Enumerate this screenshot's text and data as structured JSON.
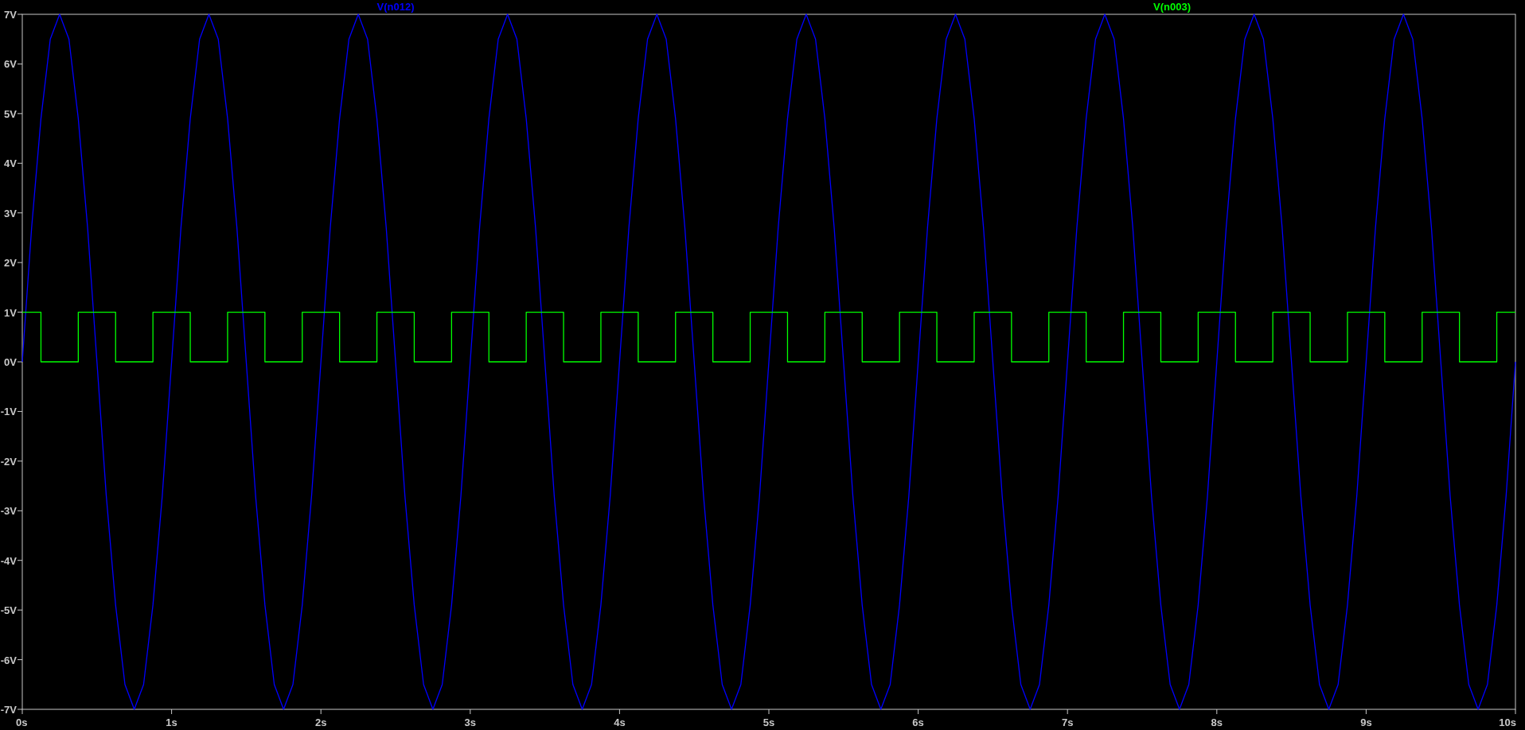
{
  "waveform_plot": {
    "chart_data": {
      "type": "line",
      "x": [
        0,
        0.0625,
        0.125,
        0.125,
        0.1875,
        0.25,
        0.3125,
        0.375,
        0.375,
        0.4375,
        0.5,
        0.5625,
        0.625,
        0.625,
        0.6875,
        0.75,
        0.8125,
        0.875,
        0.875,
        0.9375,
        1,
        1.0625,
        1.125,
        1.125,
        1.1875,
        1.25,
        1.3125,
        1.375,
        1.375,
        1.4375,
        1.5,
        1.5625,
        1.625,
        1.625,
        1.6875,
        1.75,
        1.8125,
        1.875,
        1.875,
        1.9375,
        2,
        2.0625,
        2.125,
        2.125,
        2.1875,
        2.25,
        2.3125,
        2.375,
        2.375,
        2.4375,
        2.5,
        2.5625,
        2.625,
        2.625,
        2.6875,
        2.75,
        2.8125,
        2.875,
        2.875,
        2.9375,
        3,
        3.0625,
        3.125,
        3.125,
        3.1875,
        3.25,
        3.3125,
        3.375,
        3.375,
        3.4375,
        3.5,
        3.5625,
        3.625,
        3.625,
        3.6875,
        3.75,
        3.8125,
        3.875,
        3.875,
        3.9375,
        4,
        4.0625,
        4.125,
        4.125,
        4.1875,
        4.25,
        4.3125,
        4.375,
        4.375,
        4.4375,
        4.5,
        4.5625,
        4.625,
        4.625,
        4.6875,
        4.75,
        4.8125,
        4.875,
        4.875,
        4.9375,
        5,
        5.0625,
        5.125,
        5.125,
        5.1875,
        5.25,
        5.3125,
        5.375,
        5.375,
        5.4375,
        5.5,
        5.5625,
        5.625,
        5.625,
        5.6875,
        5.75,
        5.8125,
        5.875,
        5.875,
        5.9375,
        6,
        6.0625,
        6.125,
        6.125,
        6.1875,
        6.25,
        6.3125,
        6.375,
        6.375,
        6.4375,
        6.5,
        6.5625,
        6.625,
        6.625,
        6.6875,
        6.75,
        6.8125,
        6.875,
        6.875,
        6.9375,
        7,
        7.0625,
        7.125,
        7.125,
        7.1875,
        7.25,
        7.3125,
        7.375,
        7.375,
        7.4375,
        7.5,
        7.5625,
        7.625,
        7.625,
        7.6875,
        7.75,
        7.8125,
        7.875,
        7.875,
        7.9375,
        8,
        8.0625,
        8.125,
        8.125,
        8.1875,
        8.25,
        8.3125,
        8.375,
        8.375,
        8.4375,
        8.5,
        8.5625,
        8.625,
        8.625,
        8.6875,
        8.75,
        8.8125,
        8.875,
        8.875,
        8.9375,
        9,
        9.0625,
        9.125,
        9.125,
        9.1875,
        9.25,
        9.3125,
        9.375,
        9.375,
        9.4375,
        9.5,
        9.5625,
        9.625,
        9.625,
        9.6875,
        9.75,
        9.8125,
        9.875,
        9.875,
        9.9375,
        10
      ],
      "series": [
        {
          "name": "V(n012)",
          "color": "#0000ff",
          "values": [
            0,
            2.7,
            4.9,
            4.9,
            6.5,
            7,
            6.5,
            4.9,
            4.9,
            2.7,
            0,
            -2.7,
            -4.9,
            -4.9,
            -6.5,
            -7,
            -6.5,
            -4.9,
            -4.9,
            -2.7,
            0,
            2.7,
            4.9,
            4.9,
            6.5,
            7,
            6.5,
            4.9,
            4.9,
            2.7,
            0,
            -2.7,
            -4.9,
            -4.9,
            -6.5,
            -7,
            -6.5,
            -4.9,
            -4.9,
            -2.7,
            0,
            2.7,
            4.9,
            4.9,
            6.5,
            7,
            6.5,
            4.9,
            4.9,
            2.7,
            0,
            -2.7,
            -4.9,
            -4.9,
            -6.5,
            -7,
            -6.5,
            -4.9,
            -4.9,
            -2.7,
            0,
            2.7,
            4.9,
            4.9,
            6.5,
            7,
            6.5,
            4.9,
            4.9,
            2.7,
            0,
            -2.7,
            -4.9,
            -4.9,
            -6.5,
            -7,
            -6.5,
            -4.9,
            -4.9,
            -2.7,
            0,
            2.7,
            4.9,
            4.9,
            6.5,
            7,
            6.5,
            4.9,
            4.9,
            2.7,
            0,
            -2.7,
            -4.9,
            -4.9,
            -6.5,
            -7,
            -6.5,
            -4.9,
            -4.9,
            -2.7,
            0,
            2.7,
            4.9,
            4.9,
            6.5,
            7,
            6.5,
            4.9,
            4.9,
            2.7,
            0,
            -2.7,
            -4.9,
            -4.9,
            -6.5,
            -7,
            -6.5,
            -4.9,
            -4.9,
            -2.7,
            0,
            2.7,
            4.9,
            4.9,
            6.5,
            7,
            6.5,
            4.9,
            4.9,
            2.7,
            0,
            -2.7,
            -4.9,
            -4.9,
            -6.5,
            -7,
            -6.5,
            -4.9,
            -4.9,
            -2.7,
            0,
            2.7,
            4.9,
            4.9,
            6.5,
            7,
            6.5,
            4.9,
            4.9,
            2.7,
            0,
            -2.7,
            -4.9,
            -4.9,
            -6.5,
            -7,
            -6.5,
            -4.9,
            -4.9,
            -2.7,
            0,
            2.7,
            4.9,
            4.9,
            6.5,
            7,
            6.5,
            4.9,
            4.9,
            2.7,
            0,
            -2.7,
            -4.9,
            -4.9,
            -6.5,
            -7,
            -6.5,
            -4.9,
            -4.9,
            -2.7,
            0,
            2.7,
            4.9,
            4.9,
            6.5,
            7,
            6.5,
            4.9,
            4.9,
            2.7,
            0,
            -2.7,
            -4.9,
            -4.9,
            -6.5,
            -7,
            -6.5,
            -4.9,
            -4.9,
            -2.7,
            0
          ]
        },
        {
          "name": "V(n003)",
          "color": "#00ff00",
          "values": [
            1,
            1,
            1,
            0,
            0,
            0,
            0,
            0,
            1,
            1,
            1,
            1,
            1,
            0,
            0,
            0,
            0,
            0,
            1,
            1,
            1,
            1,
            1,
            0,
            0,
            0,
            0,
            0,
            1,
            1,
            1,
            1,
            1,
            0,
            0,
            0,
            0,
            0,
            1,
            1,
            1,
            1,
            1,
            0,
            0,
            0,
            0,
            0,
            1,
            1,
            1,
            1,
            1,
            0,
            0,
            0,
            0,
            0,
            1,
            1,
            1,
            1,
            1,
            0,
            0,
            0,
            0,
            0,
            1,
            1,
            1,
            1,
            1,
            0,
            0,
            0,
            0,
            0,
            1,
            1,
            1,
            1,
            1,
            0,
            0,
            0,
            0,
            0,
            1,
            1,
            1,
            1,
            1,
            0,
            0,
            0,
            0,
            0,
            1,
            1,
            1,
            1,
            1,
            0,
            0,
            0,
            0,
            0,
            1,
            1,
            1,
            1,
            1,
            0,
            0,
            0,
            0,
            0,
            1,
            1,
            1,
            1,
            1,
            0,
            0,
            0,
            0,
            0,
            1,
            1,
            1,
            1,
            1,
            0,
            0,
            0,
            0,
            0,
            1,
            1,
            1,
            1,
            1,
            0,
            0,
            0,
            0,
            0,
            1,
            1,
            1,
            1,
            1,
            0,
            0,
            0,
            0,
            0,
            1,
            1,
            1,
            1,
            1,
            0,
            0,
            0,
            0,
            0,
            1,
            1,
            1,
            1,
            1,
            0,
            0,
            0,
            0,
            0,
            1,
            1,
            1,
            1,
            1,
            0,
            0,
            0,
            0,
            0,
            1,
            1,
            1,
            1,
            1,
            0,
            0,
            0,
            0,
            0,
            1,
            1,
            1
          ]
        }
      ],
      "xlim": [
        0,
        10
      ],
      "ylim": [
        -7,
        7
      ],
      "xticks": [
        {
          "value": 0,
          "label": "0s"
        },
        {
          "value": 1,
          "label": "1s"
        },
        {
          "value": 2,
          "label": "2s"
        },
        {
          "value": 3,
          "label": "3s"
        },
        {
          "value": 4,
          "label": "4s"
        },
        {
          "value": 5,
          "label": "5s"
        },
        {
          "value": 6,
          "label": "6s"
        },
        {
          "value": 7,
          "label": "7s"
        },
        {
          "value": 8,
          "label": "8s"
        },
        {
          "value": 9,
          "label": "9s"
        },
        {
          "value": 10,
          "label": "10s"
        }
      ],
      "yticks": [
        {
          "value": 7,
          "label": "7V"
        },
        {
          "value": 6,
          "label": "6V"
        },
        {
          "value": 5,
          "label": "5V"
        },
        {
          "value": 4,
          "label": "4V"
        },
        {
          "value": 3,
          "label": "3V"
        },
        {
          "value": 2,
          "label": "2V"
        },
        {
          "value": 1,
          "label": "1V"
        },
        {
          "value": 0,
          "label": "0V"
        },
        {
          "value": -1,
          "label": "-1V"
        },
        {
          "value": -2,
          "label": "-2V"
        },
        {
          "value": -3,
          "label": "-3V"
        },
        {
          "value": -4,
          "label": "-4V"
        },
        {
          "value": -5,
          "label": "-5V"
        },
        {
          "value": -6,
          "label": "-6V"
        },
        {
          "value": -7,
          "label": "-7V"
        }
      ]
    }
  }
}
